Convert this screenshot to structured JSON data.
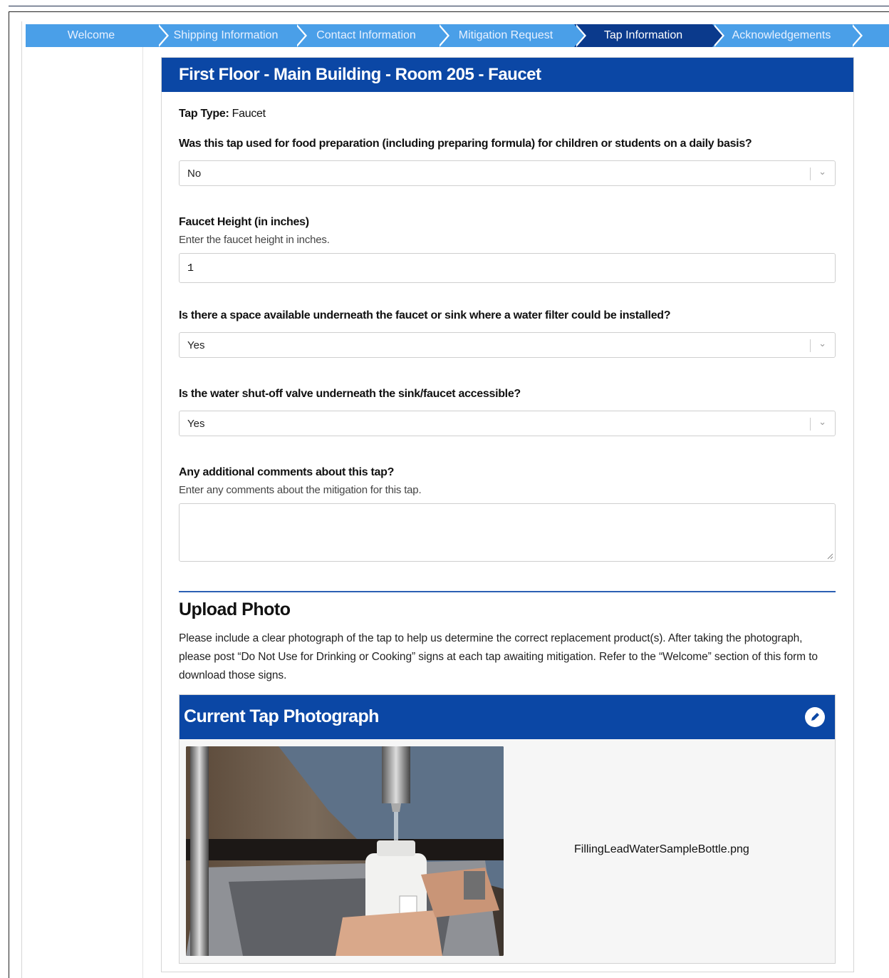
{
  "wizard": {
    "steps": [
      {
        "label": "Welcome"
      },
      {
        "label": "Shipping Information"
      },
      {
        "label": "Contact Information"
      },
      {
        "label": "Mitigation Request"
      },
      {
        "label": "Tap Information"
      },
      {
        "label": "Acknowledgements"
      }
    ],
    "active_index": 4
  },
  "card": {
    "title": "First Floor - Main Building - Room 205 - Faucet"
  },
  "form": {
    "tap_type_label": "Tap Type:",
    "tap_type_value": " Faucet",
    "food_prep": {
      "label": "Was this tap used for food preparation (including preparing formula) for children or students on a daily basis?",
      "value": "No"
    },
    "faucet_height": {
      "label": "Faucet Height (in inches)",
      "hint": "Enter the faucet height in inches.",
      "value": "1"
    },
    "filter_space": {
      "label": "Is there a space available underneath the faucet or sink where a water filter could be installed?",
      "value": "Yes"
    },
    "shutoff_valve": {
      "label": "Is the water shut-off valve underneath the sink/faucet accessible?",
      "value": "Yes"
    },
    "comments": {
      "label": "Any additional comments about this tap?",
      "hint": "Enter any comments about the mitigation for this tap.",
      "value": ""
    }
  },
  "upload": {
    "heading": "Upload Photo",
    "instructions": "Please include a clear photograph of the tap to help us determine the correct replacement product(s). After taking the photograph, please post “Do Not Use for Drinking or Cooking” signs at each tap awaiting mitigation. Refer to the “Welcome” section of this form to download those signs.",
    "photo_card_title": "Current Tap Photograph",
    "filename": "FillingLeadWaterSampleBottle.png"
  },
  "colors": {
    "header_blue": "#0b47a5",
    "step_blue": "#4a9fe8",
    "step_active": "#0b3a8c"
  }
}
